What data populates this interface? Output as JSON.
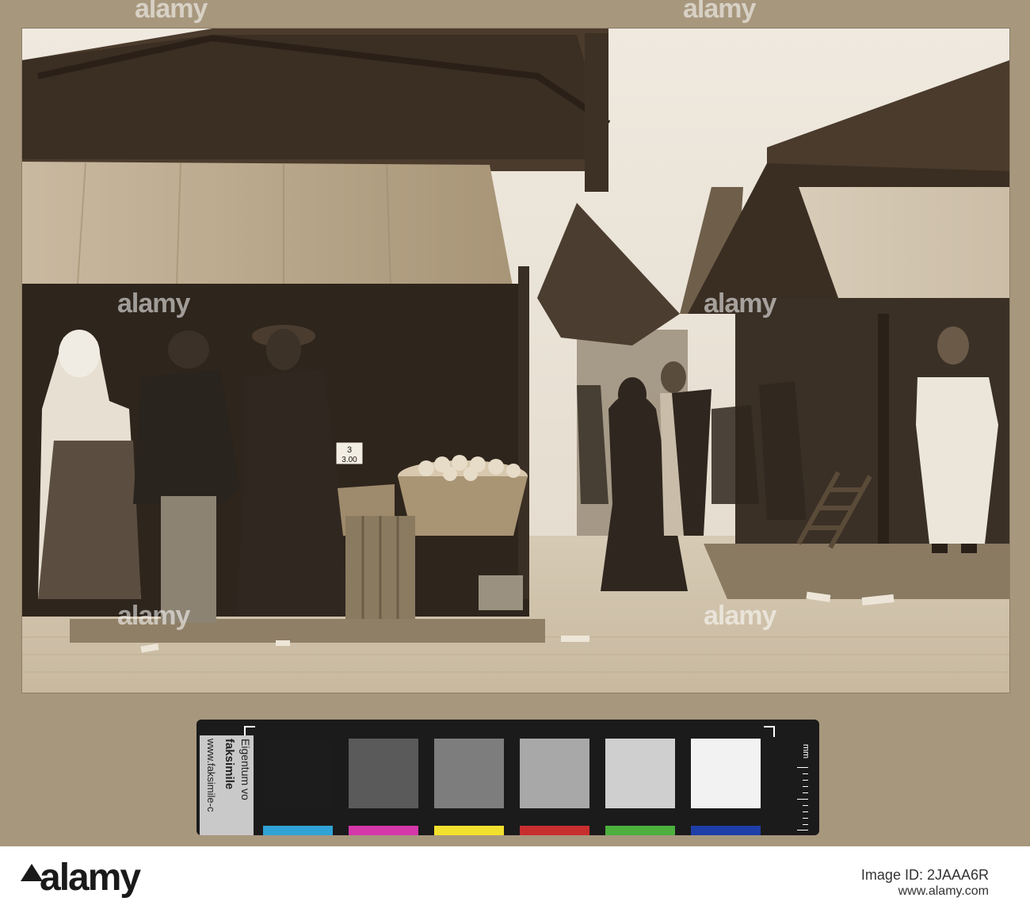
{
  "watermark": "alamy",
  "photo": {
    "sign_line1": "3",
    "sign_line2": "3.00"
  },
  "color_card": {
    "label_line1": "Eigentum vo",
    "label_line2": "faksimile",
    "label_line3": "www.faksimile-c",
    "unit": "mm",
    "gray_patches": [
      "#1c1c1c",
      "#5a5a5a",
      "#7d7d7d",
      "#a8a8a8",
      "#cfcfcf",
      "#f2f2f2"
    ],
    "color_patches": [
      "#2fa3d6",
      "#d437a9",
      "#f2e02e",
      "#c82e2e",
      "#4caf3e",
      "#1f3fa8"
    ]
  },
  "footer": {
    "brand": "alamy",
    "image_id": "Image ID: 2JAAA6R",
    "url": "www.alamy.com"
  }
}
